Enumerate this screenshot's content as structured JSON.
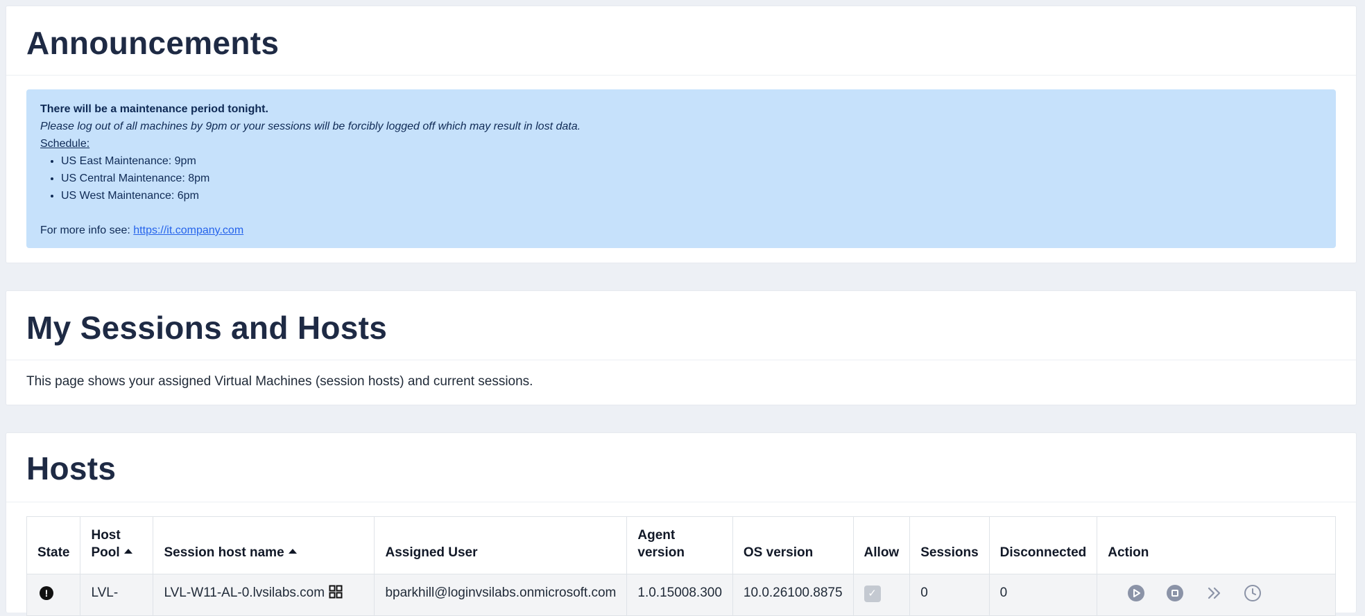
{
  "announcements": {
    "title": "Announcements",
    "headline": "There will be a maintenance period tonight.",
    "note": "Please log out of all machines by 9pm or your sessions will be forcibly logged off which may result in lost data.",
    "schedule_label": "Schedule:",
    "schedule": [
      "US East Maintenance: 9pm",
      "US Central Maintenance: 8pm",
      "US West Maintenance: 6pm"
    ],
    "more_info_prefix": "For more info see: ",
    "more_info_link": "https://it.company.com"
  },
  "sessions": {
    "title": "My Sessions and Hosts",
    "description": "This page shows your assigned Virtual Machines (session hosts) and current sessions."
  },
  "hosts": {
    "title": "Hosts",
    "columns": {
      "state": "State",
      "host_pool_1": "Host",
      "host_pool_2": "Pool",
      "session_host_name": "Session host name",
      "assigned_user": "Assigned User",
      "agent_version_1": "Agent",
      "agent_version_2": "version",
      "os_version": "OS version",
      "allow": "Allow",
      "sessions": "Sessions",
      "disconnected": "Disconnected",
      "action": "Action"
    },
    "rows": [
      {
        "state_icon": "alert-circle-icon",
        "host_pool": "LVL-",
        "session_host_name": "LVL-W11-AL-0.lvsilabs.com",
        "assigned_user": "bparkhill@loginvsilabs.onmicrosoft.com",
        "agent_version": "1.0.15008.300",
        "os_version": "10.0.26100.8875",
        "allow": true,
        "sessions": "0",
        "disconnected": "0",
        "actions": [
          "start-icon",
          "stop-icon",
          "drain-icon",
          "schedule-icon"
        ]
      }
    ]
  },
  "colors": {
    "page_bg": "#edf0f5",
    "card_bg": "#ffffff",
    "announcement_bg": "#c6e1fb",
    "announcement_text": "#0f2a55",
    "link": "#2563eb",
    "title": "#1e2a44",
    "action_icon": "#8b93a7"
  }
}
